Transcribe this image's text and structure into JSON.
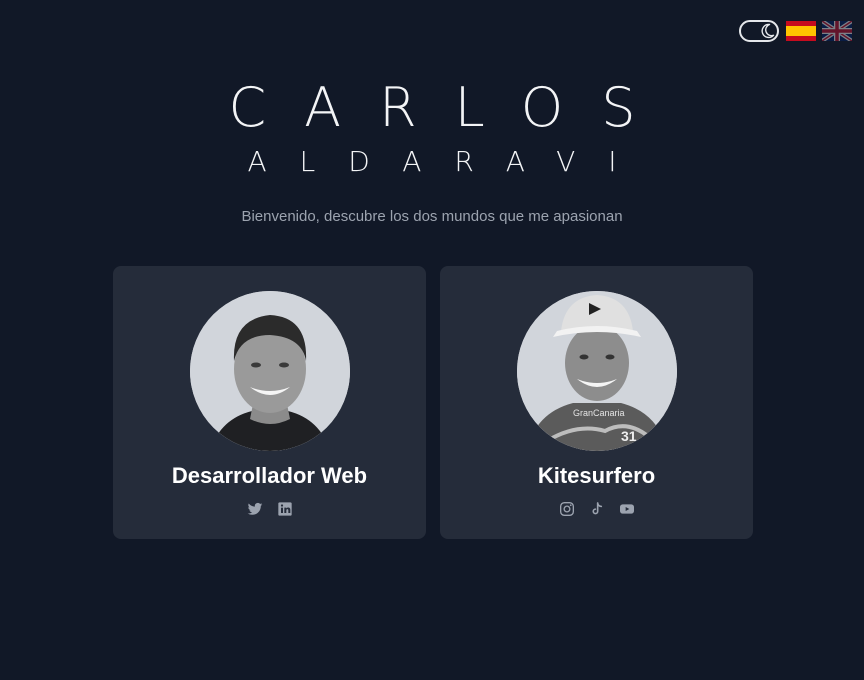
{
  "header": {
    "first_name": "CARLOS",
    "last_name": "ALDARAVI",
    "subtitle": "Bienvenido, descubre los dos mundos que me apasionan"
  },
  "controls": {
    "theme_icon": "moon-icon",
    "languages": [
      {
        "code": "es",
        "icon": "spain-flag-icon"
      },
      {
        "code": "en",
        "icon": "uk-flag-icon"
      }
    ]
  },
  "cards": [
    {
      "title": "Desarrollador Web",
      "avatar": "portrait-web-developer",
      "social": [
        "twitter-icon",
        "linkedin-icon"
      ]
    },
    {
      "title": "Kitesurfero",
      "avatar": "portrait-kitesurfer",
      "social": [
        "instagram-icon",
        "tiktok-icon",
        "youtube-icon"
      ]
    }
  ],
  "colors": {
    "background": "#111827",
    "card": "#252c3a",
    "icon": "#9ca3af",
    "subtitle": "#9ca3af"
  }
}
